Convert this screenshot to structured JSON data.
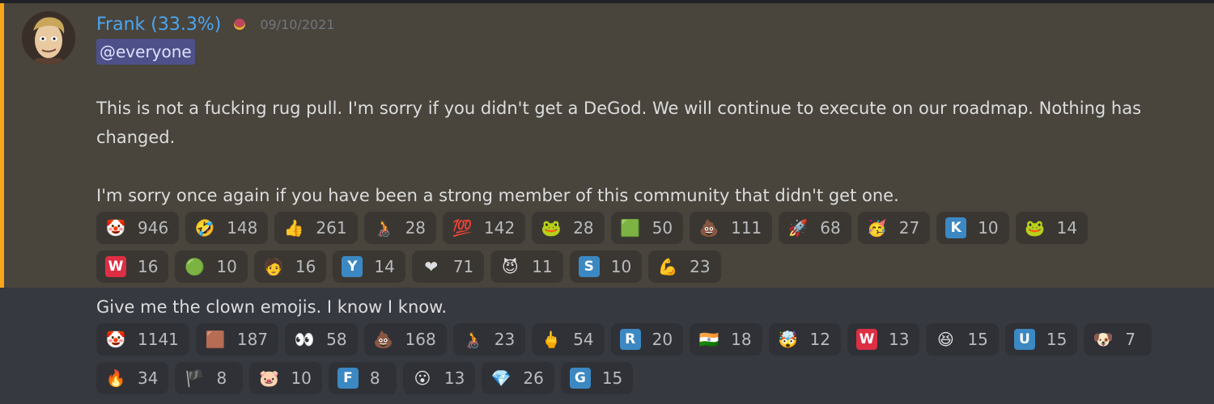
{
  "message1": {
    "author": "Frank (33.3%)",
    "timestamp": "09/10/2021",
    "mention": "@everyone",
    "paragraph1": "This is not a fucking rug pull. I'm sorry if you didn't get a DeGod. We will continue to execute on our roadmap. Nothing has changed.",
    "paragraph2": "I'm sorry once again if you have been a strong member of this community that didn't get one.",
    "reactions": [
      {
        "icon": "clown-emoji",
        "glyph": "🤡",
        "count": "946"
      },
      {
        "icon": "rofl-emoji",
        "glyph": "🤣",
        "count": "148"
      },
      {
        "icon": "thumbs-up-emoji",
        "glyph": "👍",
        "count": "261"
      },
      {
        "icon": "wheelchair-emoji",
        "glyph": "🧑‍🦽",
        "count": "28"
      },
      {
        "icon": "hundred-emoji",
        "glyph": "💯",
        "count": "142"
      },
      {
        "icon": "pepe-custom-emoji",
        "glyph": "🐸",
        "count": "28"
      },
      {
        "icon": "green-custom-emoji",
        "glyph": "🟩",
        "count": "50"
      },
      {
        "icon": "poop-emoji",
        "glyph": "💩",
        "count": "111"
      },
      {
        "icon": "rocket-emoji",
        "glyph": "🚀",
        "count": "68"
      },
      {
        "icon": "partying-face-emoji",
        "glyph": "🥳",
        "count": "27"
      },
      {
        "icon": "letter-k-emoji",
        "letter": "K",
        "color": "#3b88c3",
        "count": "10"
      },
      {
        "icon": "pepe-hands-emoji",
        "glyph": "🐸",
        "count": "14"
      },
      {
        "icon": "letter-w-emoji",
        "letter": "W",
        "color": "#dd2e44",
        "count": "16"
      },
      {
        "icon": "green-blob-emoji",
        "glyph": "🟢",
        "count": "10"
      },
      {
        "icon": "person-orange-emoji",
        "glyph": "🧑",
        "count": "16"
      },
      {
        "icon": "letter-y-emoji",
        "letter": "Y",
        "color": "#3b88c3",
        "count": "14"
      },
      {
        "icon": "red-heart-emoji",
        "glyph": "❤",
        "count": "71"
      },
      {
        "icon": "smiling-imp-emoji",
        "glyph": "😈",
        "count": "11"
      },
      {
        "icon": "letter-s-emoji",
        "letter": "S",
        "color": "#3b88c3",
        "count": "10"
      },
      {
        "icon": "flexed-biceps-emoji",
        "glyph": "💪",
        "count": "23"
      }
    ]
  },
  "message2": {
    "text": "Give me the clown emojis. I know I know.",
    "reactions": [
      {
        "icon": "clown-emoji",
        "glyph": "🤡",
        "count": "1141"
      },
      {
        "icon": "custom-face-emoji",
        "glyph": "🟫",
        "count": "187"
      },
      {
        "icon": "eyes-emoji",
        "glyph": "👀",
        "count": "58"
      },
      {
        "icon": "poop-emoji",
        "glyph": "💩",
        "count": "168"
      },
      {
        "icon": "wheelchair-emoji",
        "glyph": "🧑‍🦽",
        "count": "23"
      },
      {
        "icon": "middle-finger-emoji",
        "glyph": "🖕",
        "count": "54"
      },
      {
        "icon": "letter-r-emoji",
        "letter": "R",
        "color": "#3b88c3",
        "count": "20"
      },
      {
        "icon": "india-flag-emoji",
        "glyph": "🇮🇳",
        "count": "18"
      },
      {
        "icon": "custom-pink-emoji",
        "glyph": "🤯",
        "count": "12"
      },
      {
        "icon": "letter-w-emoji",
        "letter": "W",
        "color": "#dd2e44",
        "count": "13"
      },
      {
        "icon": "grinning-squinting-emoji",
        "glyph": "😆",
        "count": "15"
      },
      {
        "icon": "letter-u-emoji",
        "letter": "U",
        "color": "#3b88c3",
        "count": "15"
      },
      {
        "icon": "custom-photo-emoji",
        "glyph": "🐶",
        "count": "7"
      },
      {
        "icon": "fire-emoji",
        "glyph": "🔥",
        "count": "34"
      },
      {
        "icon": "custom-red-emoji",
        "glyph": "🏴",
        "count": "8"
      },
      {
        "icon": "pig-face-emoji",
        "glyph": "🐷",
        "count": "10"
      },
      {
        "icon": "letter-f-emoji",
        "letter": "F",
        "color": "#3b88c3",
        "count": "8"
      },
      {
        "icon": "custom-face-emoji-2",
        "glyph": "😮",
        "count": "13"
      },
      {
        "icon": "gem-stone-emoji",
        "glyph": "💎",
        "count": "26"
      },
      {
        "icon": "letter-g-emoji",
        "letter": "G",
        "color": "#3b88c3",
        "count": "15"
      }
    ]
  }
}
